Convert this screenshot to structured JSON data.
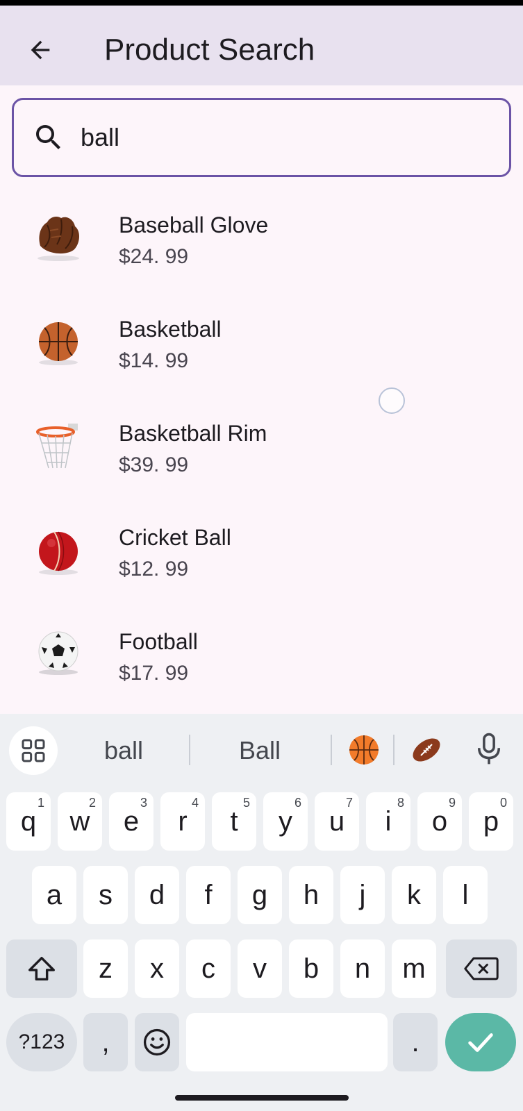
{
  "app_bar": {
    "title": "Product Search"
  },
  "search": {
    "value": "ball",
    "placeholder": ""
  },
  "products": [
    {
      "name": "Baseball Glove",
      "price": "$24. 99"
    },
    {
      "name": "Basketball",
      "price": "$14. 99"
    },
    {
      "name": "Basketball Rim",
      "price": "$39. 99"
    },
    {
      "name": "Cricket Ball",
      "price": "$12. 99"
    },
    {
      "name": "Football",
      "price": "$17. 99"
    }
  ],
  "keyboard": {
    "suggestions": [
      "ball",
      "Ball"
    ],
    "emoji_suggestions": [
      "basketball-emoji",
      "american-football-emoji"
    ],
    "row1": [
      {
        "key": "q",
        "hint": "1"
      },
      {
        "key": "w",
        "hint": "2"
      },
      {
        "key": "e",
        "hint": "3"
      },
      {
        "key": "r",
        "hint": "4"
      },
      {
        "key": "t",
        "hint": "5"
      },
      {
        "key": "y",
        "hint": "6"
      },
      {
        "key": "u",
        "hint": "7"
      },
      {
        "key": "i",
        "hint": "8"
      },
      {
        "key": "o",
        "hint": "9"
      },
      {
        "key": "p",
        "hint": "0"
      }
    ],
    "row2": [
      "a",
      "s",
      "d",
      "f",
      "g",
      "h",
      "j",
      "k",
      "l"
    ],
    "row3": [
      "z",
      "x",
      "c",
      "v",
      "b",
      "n",
      "m"
    ],
    "symbols_label": "?123",
    "comma_label": ",",
    "period_label": "."
  },
  "colors": {
    "accent": "#6b53a6",
    "app_bar_bg": "#e8e1ef",
    "page_bg": "#fdf5fa",
    "enter_key": "#5bb8a6"
  }
}
